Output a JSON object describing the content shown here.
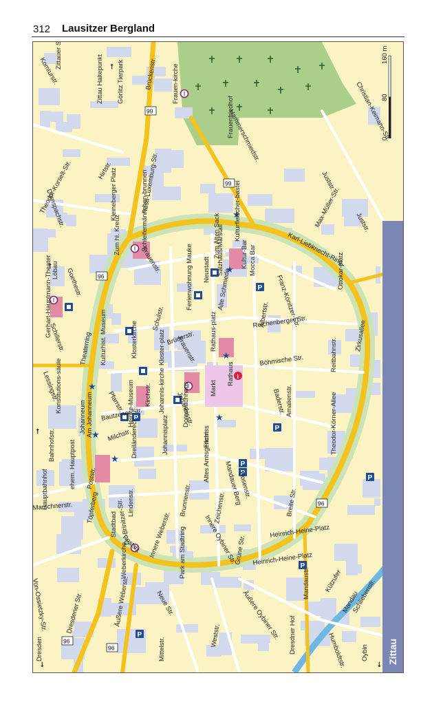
{
  "page": {
    "number": "312",
    "running_title": "Lausitzer Bergland",
    "side_tab": "Zittau"
  },
  "map": {
    "scale": {
      "ticks": [
        "0",
        "80",
        "160 m"
      ]
    },
    "colors": {
      "background": "#fbf3c4",
      "block": "#d3d9ec",
      "main_road": "#f3c21d",
      "street": "#ffffff",
      "ring_green": "#cbe3b6",
      "cemetery": "#a9cf8a",
      "water": "#6fb7e3",
      "tab": "#7a87b4",
      "highlight_red": "#e38aa4",
      "highlight_pink": "#ecc7e9",
      "icon_blue": "#1f4c93"
    },
    "streets": [
      "Komturstr.",
      "Zittauer Schmalspurbahn",
      "Zittau Haltepunkt",
      "Görlitz Tierpark",
      "Brückenstr.",
      "Frauenfriedhof",
      "Frauen-kirche",
      "Hammerschmiedstr.",
      "Christian-Keimann-Str.",
      "Theodor-Korselt-Str.",
      "Hirtstr.",
      "Rosa-Luxemburg-Str.",
      "Dornspachstr.",
      "Kleineberger Platz",
      "Schleifermännchen-brunnen",
      "Juststr.",
      "Max-Müller-Str.",
      "Juststr.",
      "Karl-Liebknecht-Ring",
      "Kulturfleischer-bastei",
      "Goethestr.",
      "Löbau",
      "Zum hl. Kreuz",
      "Frauenstr.",
      "Zum Alten Sack",
      "Salzhaus/Marstall",
      "Kultur-Bar",
      "Ferienwohnung Mauke",
      "Neustadt",
      "Mocca Bar",
      "Franz-Könitzer-Str.",
      "Schillerstr.",
      "Gerhart-Hauptmann-Theater",
      "Kulturhist. Museum",
      "Klosterkirche",
      "Kloster-platz",
      "Schulstr.",
      "Frauenstr.",
      "Albertstr.",
      "Alte Schmiede",
      "Ottokar-platz",
      "Reichenberger Str.",
      "Lessingstr.",
      "Theaterring",
      "Brüderstr.",
      "Rathaus-platz",
      "Reitbahnstr.",
      "Zirkusallee",
      "Böhmische Str.",
      "Rathaus",
      "Johannisstr.",
      "Pfarrstr.",
      "Johannis-kirche",
      "Heinke-Museum",
      "Johanneum",
      "Markt",
      "Kirchstr.",
      "Konstitutions-säule",
      "Am Johanneum",
      "Filmriss",
      "Baderstr.",
      "Amalienstr.",
      "Bahnhofstr.",
      "Bautzener Str.",
      "Dreiländereck",
      "Johannisplatz",
      "Dornspachhaus",
      "Altes Amtsgericht",
      "Mandauer Berg",
      "Theodor-Körner-Allee",
      "Hauptbahnhof",
      "ehem. Hauptpost",
      "Poststr.",
      "Milchstr.",
      "Brunnenstr.",
      "Rosenstr.",
      "Breite Str.",
      "Töpferberg",
      "Stadtbad",
      "Lindenstr.",
      "Innere Weberstr.",
      "Zeichenstr.",
      "Grüne Str.",
      "Marschnerstr.",
      "Poststr.",
      "Innere Oybiner Str.",
      "Heinrich-Heine-Platz",
      "Heinrich-Heine-Platz",
      "Weberkirche",
      "Park am Stadtring",
      "Von-Ossietzky-Str.",
      "Dr.-Brinitzer-Str.",
      "Äußere Oybiner Str.",
      "Kützufer",
      "Mandau",
      "Schliebenstr.",
      "Dresdener Str.",
      "Äußere Weberstr.",
      "Neue Str.",
      "Mittelstr.",
      "Weststr.",
      "Mandaustr.",
      "Dresdner Hof",
      "Humboldtstr.",
      "Oybin",
      "Dresden"
    ],
    "road_numbers": [
      "99",
      "99",
      "96",
      "96",
      "96",
      "96"
    ]
  }
}
